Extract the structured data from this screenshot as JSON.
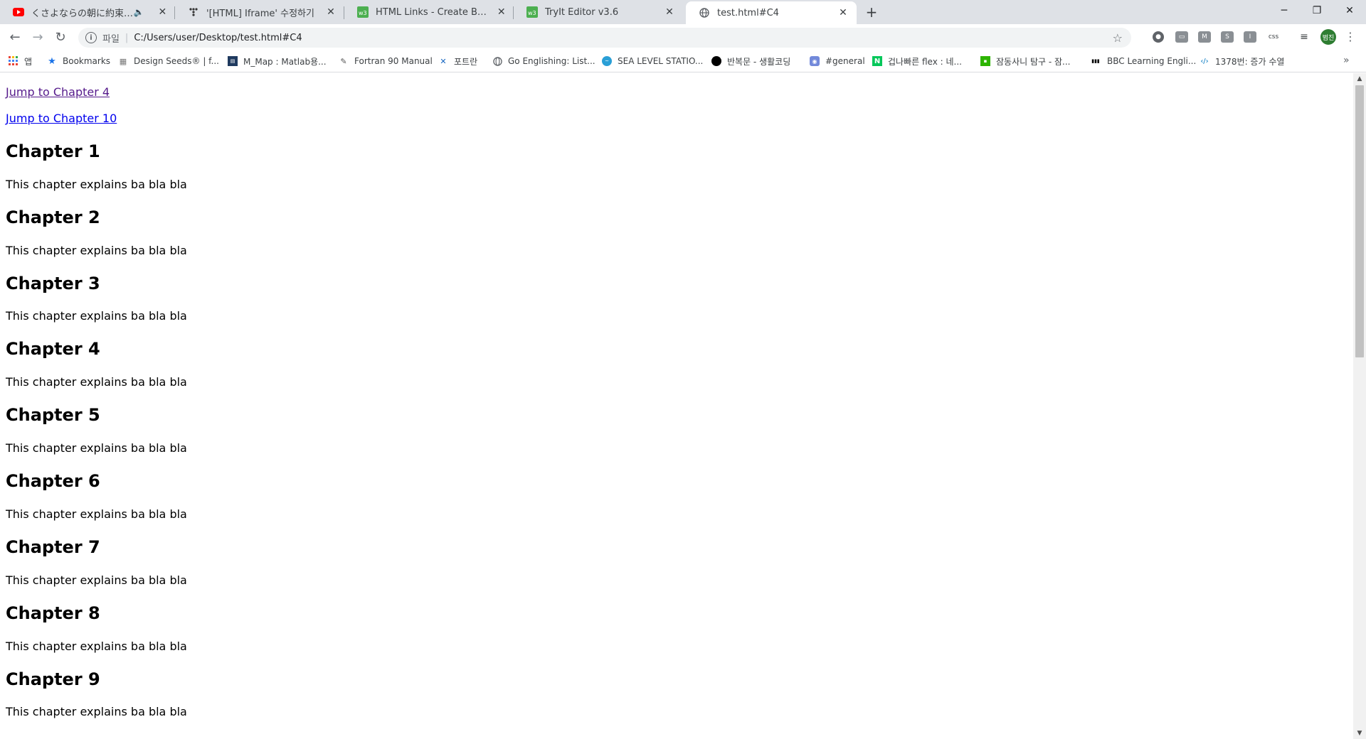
{
  "tabs": [
    {
      "title": "くさよならの朝に約束の花を",
      "favicon": "youtube-icon",
      "muted": true,
      "active": false
    },
    {
      "title": "'[HTML] Iframe' 수정하기",
      "favicon": "dots-icon",
      "active": false
    },
    {
      "title": "HTML Links - Create Bookmark",
      "favicon": "w3schools-icon",
      "active": false
    },
    {
      "title": "TryIt Editor v3.6",
      "favicon": "w3schools-icon",
      "active": false
    },
    {
      "title": "test.html#C4",
      "favicon": "globe-icon",
      "active": true
    }
  ],
  "window": {
    "minimize": "─",
    "restore": "❐",
    "close": "✕"
  },
  "toolbar": {
    "scheme_label": "파일",
    "url": "C:/Users/user/Desktop/test.html#C4",
    "avatar_label": "범진",
    "extensions": [
      "ext-circle",
      "ext-screen",
      "ext-m",
      "ext-s",
      "ext-i",
      "ext-css",
      "ext-playlist"
    ],
    "ext_labels": [
      "●",
      "▭",
      "M",
      "S",
      "I",
      "css",
      "≡"
    ]
  },
  "bookmarks": [
    {
      "label": "앱",
      "icon": "apps-grid-icon"
    },
    {
      "label": "Bookmarks",
      "icon": "star-icon"
    },
    {
      "label": "Design Seeds® | f...",
      "icon": "designseeds-icon"
    },
    {
      "label": "M_Map : Matlab용...",
      "icon": "map-icon"
    },
    {
      "label": "Fortran 90 Manual",
      "icon": "fortran-icon"
    },
    {
      "label": "포트란",
      "icon": "cross-icon"
    },
    {
      "label": "Go Englishing: List...",
      "icon": "globe-icon"
    },
    {
      "label": "SEA LEVEL STATIO...",
      "icon": "sea-level-icon"
    },
    {
      "label": "반복문 - 생활코딩",
      "icon": "black-circle-icon"
    },
    {
      "label": "#general",
      "icon": "discord-icon"
    },
    {
      "label": "겁나빠른 flex : 네...",
      "icon": "naver-icon"
    },
    {
      "label": "잠동사니 탐구 - 잠...",
      "icon": "green-square-icon"
    },
    {
      "label": "BBC Learning Engli...",
      "icon": "bbc-icon"
    },
    {
      "label": "1378번: 증가 수열",
      "icon": "code-icon"
    }
  ],
  "page": {
    "links": [
      "Jump to Chapter 4",
      "Jump to Chapter 10"
    ],
    "chapters": [
      {
        "heading": "Chapter 1",
        "text": "This chapter explains ba bla bla"
      },
      {
        "heading": "Chapter 2",
        "text": "This chapter explains ba bla bla"
      },
      {
        "heading": "Chapter 3",
        "text": "This chapter explains ba bla bla"
      },
      {
        "heading": "Chapter 4",
        "text": "This chapter explains ba bla bla"
      },
      {
        "heading": "Chapter 5",
        "text": "This chapter explains ba bla bla"
      },
      {
        "heading": "Chapter 6",
        "text": "This chapter explains ba bla bla"
      },
      {
        "heading": "Chapter 7",
        "text": "This chapter explains ba bla bla"
      },
      {
        "heading": "Chapter 8",
        "text": "This chapter explains ba bla bla"
      },
      {
        "heading": "Chapter 9",
        "text": "This chapter explains ba bla bla"
      }
    ]
  },
  "colors": {
    "visited_link": "#551a8b",
    "unvisited_link": "#0000ee",
    "tabstrip": "#dee1e6",
    "avatar": "#2e7d32"
  }
}
